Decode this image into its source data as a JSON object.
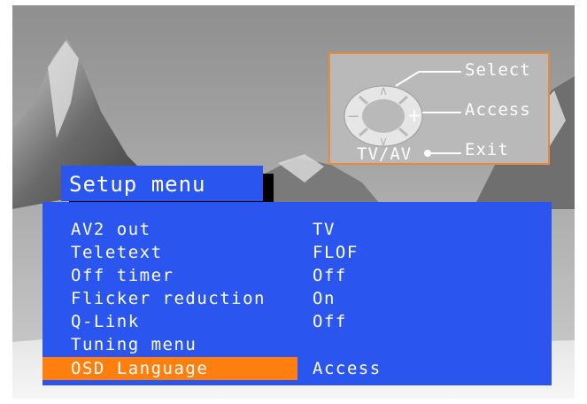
{
  "help": {
    "select_label": "Select",
    "access_label": "Access",
    "exit_label": "Exit",
    "tvav_label": "TV/AV",
    "up_symbol": "∧",
    "down_symbol": "∨",
    "minus_symbol": "−",
    "plus_symbol": "+"
  },
  "menu": {
    "title": "Setup menu",
    "items": [
      {
        "label": "AV2 out",
        "value": "TV"
      },
      {
        "label": "Teletext",
        "value": "FLOF"
      },
      {
        "label": "Off timer",
        "value": "Off"
      },
      {
        "label": "Flicker reduction",
        "value": "On"
      },
      {
        "label": "Q-Link",
        "value": "Off"
      },
      {
        "label": "Tuning menu",
        "value": ""
      },
      {
        "label": "OSD Language",
        "value": "Access"
      }
    ],
    "selected_index": 6
  },
  "colors": {
    "menu_bg": "#2a55ef",
    "highlight": "#ff7f0e",
    "help_border": "#e88a3a",
    "help_bg": "#b9b9b9",
    "text": "#ffffff"
  }
}
